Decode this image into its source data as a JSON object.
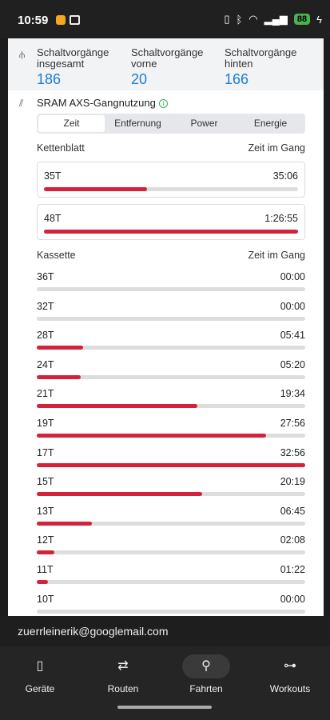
{
  "statusbar": {
    "time": "10:59",
    "battery": "88"
  },
  "stats": [
    {
      "label": "Schaltvorgänge insgesamt",
      "value": "186"
    },
    {
      "label": "Schaltvorgänge vorne",
      "value": "20"
    },
    {
      "label": "Schaltvorgänge hinten",
      "value": "166"
    }
  ],
  "section": {
    "title": "SRAM AXS-Gangnutzung"
  },
  "tabs": [
    "Zeit",
    "Entfernung",
    "Power",
    "Energie"
  ],
  "chainring": {
    "header": "Kettenblatt",
    "col": "Zeit im Gang",
    "items": [
      {
        "label": "35T",
        "time": "35:06",
        "fraction": 0.405
      },
      {
        "label": "48T",
        "time": "1:26:55",
        "fraction": 1.0
      }
    ]
  },
  "cassette": {
    "header": "Kassette",
    "col": "Zeit im Gang",
    "items": [
      {
        "label": "36T",
        "time": "00:00",
        "fraction": 0.0
      },
      {
        "label": "32T",
        "time": "00:00",
        "fraction": 0.0
      },
      {
        "label": "28T",
        "time": "05:41",
        "fraction": 0.174
      },
      {
        "label": "24T",
        "time": "05:20",
        "fraction": 0.163
      },
      {
        "label": "21T",
        "time": "19:34",
        "fraction": 0.597
      },
      {
        "label": "19T",
        "time": "27:56",
        "fraction": 0.853
      },
      {
        "label": "17T",
        "time": "32:56",
        "fraction": 1.0
      },
      {
        "label": "15T",
        "time": "20:19",
        "fraction": 0.617
      },
      {
        "label": "13T",
        "time": "06:45",
        "fraction": 0.205
      },
      {
        "label": "12T",
        "time": "02:08",
        "fraction": 0.065
      },
      {
        "label": "11T",
        "time": "01:22",
        "fraction": 0.042
      },
      {
        "label": "10T",
        "time": "00:00",
        "fraction": 0.0
      }
    ]
  },
  "account": {
    "email": "zuerrleinerik@googlemail.com"
  },
  "nav": [
    {
      "label": "Geräte",
      "icon": "device-icon",
      "glyph": "▯",
      "active": false
    },
    {
      "label": "Routen",
      "icon": "route-icon",
      "glyph": "⇄",
      "active": false
    },
    {
      "label": "Fahrten",
      "icon": "bike-icon",
      "glyph": "⚲",
      "active": true
    },
    {
      "label": "Workouts",
      "icon": "dumbbell-icon",
      "glyph": "⊶",
      "active": false
    }
  ]
}
